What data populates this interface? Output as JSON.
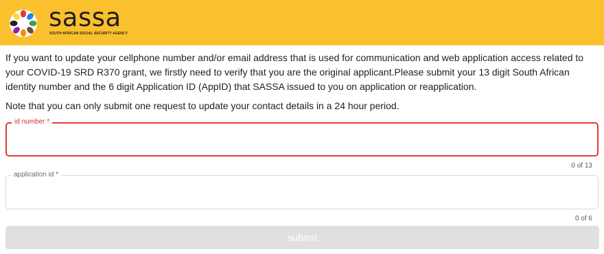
{
  "header": {
    "brand_name": "sassa",
    "brand_subtitle": "SOUTH AFRICAN SOCIAL SECURITY AGENCY",
    "background_color": "#fbc02d",
    "logo_icon": "hands-circle-logo-icon"
  },
  "content": {
    "intro_text": "If you want to update your cellphone number and/or email address that is used for communication and web application access related to your COVID-19 SRD R370 grant, we firstly need to verify that you are the original applicant.Please submit your 13 digit South African identity number and the 6 digit Application ID (AppID) that SASSA issued to you on application or reapplication.",
    "note_text": "Note that you can only submit one request to update your contact details in a 24 hour period."
  },
  "form": {
    "id_number": {
      "label": "id number *",
      "value": "",
      "counter": "0 of 13",
      "max_length": 13,
      "state_color": "#e53935"
    },
    "application_id": {
      "label": "application id *",
      "value": "",
      "counter": "0 of 6",
      "max_length": 6
    },
    "submit_label": "submit",
    "submit_disabled": true
  }
}
